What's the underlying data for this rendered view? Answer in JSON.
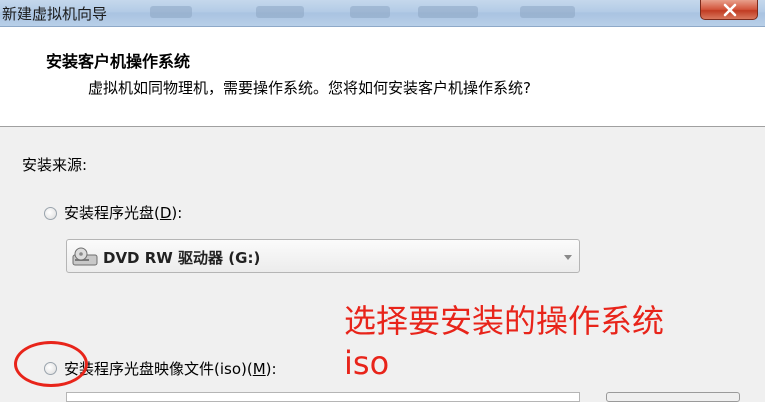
{
  "window": {
    "title": "新建虚拟机向导",
    "close_label": "×"
  },
  "header": {
    "title": "安装客户机操作系统",
    "subtitle": "虚拟机如同物理机，需要操作系统。您将如何安装客户机操作系统?"
  },
  "install_source": {
    "label": "安装来源:",
    "option_disc": {
      "label_prefix": "安装程序光盘(",
      "accelerator": "D",
      "label_suffix": "):",
      "selected": false
    },
    "disc_dropdown": {
      "selected_value": "DVD RW 驱动器 (G:)",
      "icon": "dvd-drive-icon"
    },
    "option_iso": {
      "label_prefix": "安装程序光盘映像文件(iso)(",
      "accelerator": "M",
      "label_suffix": "):",
      "selected": false
    }
  },
  "annotation": {
    "line1": "选择要安装的操作系统",
    "line2": "iso",
    "color": "#e8241a"
  },
  "colors": {
    "titlebar": "#b3cbe6",
    "close_button": "#c13b22",
    "header_bg": "#ffffff",
    "body_bg": "#f0f0f0"
  }
}
